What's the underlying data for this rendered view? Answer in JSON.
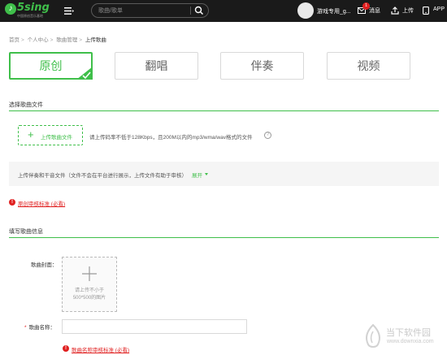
{
  "header": {
    "logo_text": "5sing",
    "logo_subtitle": "中国原创音乐基地",
    "search_placeholder": "歌曲/歌单",
    "username": "游戏专用_g...",
    "messages": {
      "badge": "1",
      "label": "消息"
    },
    "upload_label": "上传",
    "app_label": "APP"
  },
  "breadcrumb": [
    "首页",
    "个人中心",
    "歌曲管理",
    "上传歌曲"
  ],
  "type_tabs": [
    {
      "label": "原创",
      "active": true
    },
    {
      "label": "翻唱",
      "active": false
    },
    {
      "label": "伴奏",
      "active": false
    },
    {
      "label": "视频",
      "active": false
    }
  ],
  "select_section": {
    "title": "选择歌曲文件",
    "upload_button": "上传歌曲文件",
    "upload_hint": "请上传码率不低于128Kbps，且200M以内的mp3/wma/wav格式的文件",
    "help": "?",
    "accompaniment_text": "上传伴奏和干音文件（文件不会在平台进行展示，上传文件有助于审核）",
    "expand_label": "展开"
  },
  "warning_original": "原创审核标准 (必看)",
  "info_section": {
    "title": "填写歌曲信息",
    "cover_label": "歌曲封面：",
    "cover_hint_line1": "请上传不小于",
    "cover_hint_line2": "500*500的图片",
    "name_required_mark": "*",
    "name_label": "歌曲名称：",
    "name_value": "",
    "warning_name": "歌曲名称审核标准 (必看)"
  },
  "watermark": {
    "title": "当下软件园",
    "url": "www.downxia.com"
  },
  "colors": {
    "accent": "#3fbf4a",
    "topbar": "#1a1a1a",
    "warning": "#e02020"
  }
}
